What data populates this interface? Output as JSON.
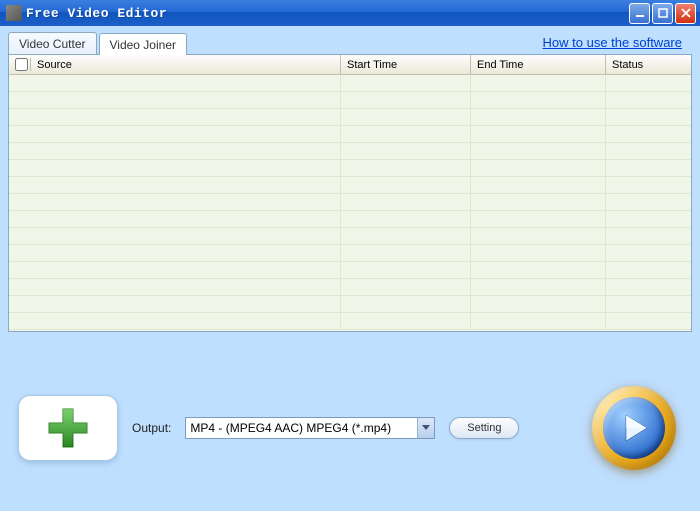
{
  "window": {
    "title": "Free Video Editor"
  },
  "tabs": {
    "cutter": "Video Cutter",
    "joiner": "Video Joiner",
    "active": "joiner"
  },
  "help_link": "How to use the software",
  "columns": {
    "source": "Source",
    "start": "Start Time",
    "end": "End Time",
    "status": "Status"
  },
  "output": {
    "label": "Output:",
    "value": "MP4 - (MPEG4 AAC) MPEG4 (*.mp4)"
  },
  "setting_label": "Setting",
  "rows": []
}
